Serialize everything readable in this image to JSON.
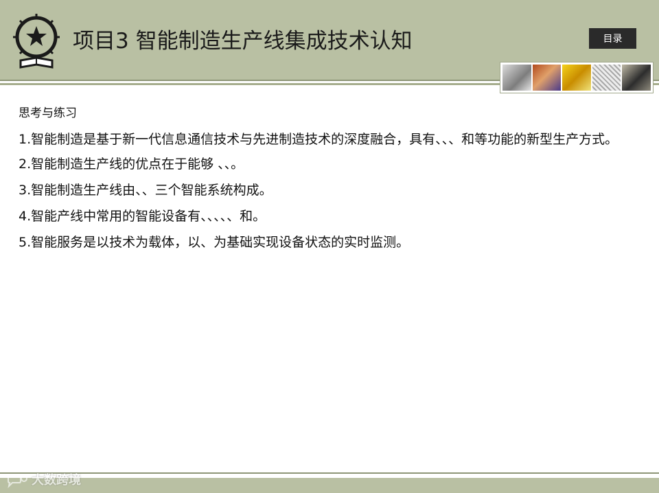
{
  "header": {
    "title": "项目3  智能制造生产线集成技术认知",
    "toc_label": "目录",
    "logo_icon": "star-book-emblem-icon",
    "colors": {
      "band": "#b9c0a3",
      "button": "#2a2a2a"
    }
  },
  "content": {
    "section_title": "思考与练习",
    "questions": [
      "1.智能制造是基于新一代信息通信技术与先进制造技术的深度融合，具有、、、和等功能的新型生产方式。",
      "2.智能制造生产线的优点在于能够    、、。",
      "3.智能制造生产线由、、三个智能系统构成。",
      "4.智能产线中常用的智能设备有、、、、、和。",
      "5.智能服务是以技术为载体，以、为基础实现设备状态的实时监测。"
    ]
  },
  "footer": {
    "watermark_text": "大数跨境",
    "watermark_icon": "chat-bubble-icon"
  }
}
